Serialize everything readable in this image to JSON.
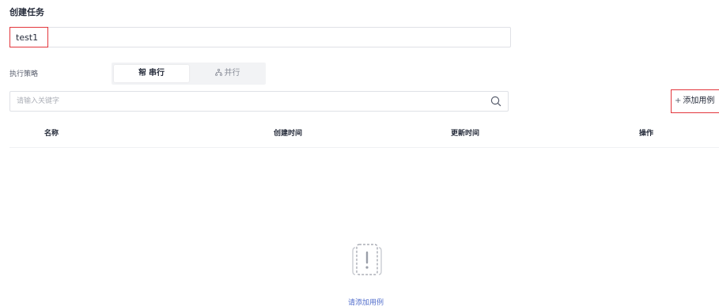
{
  "header": {
    "title": "创建任务"
  },
  "task_name": {
    "value": "test1"
  },
  "strategy": {
    "label": "执行策略",
    "options": [
      {
        "label": "串行",
        "icon": "serial-icon",
        "selected": true
      },
      {
        "label": "并行",
        "icon": "parallel-icon",
        "selected": false
      }
    ]
  },
  "search": {
    "placeholder": "请输入关键字",
    "icon": "search-icon"
  },
  "add_case": {
    "label": "添加用例",
    "icon": "plus-icon"
  },
  "table": {
    "columns": [
      "名称",
      "创建时间",
      "更新时间",
      "操作"
    ],
    "rows": []
  },
  "empty_state": {
    "icon": "empty-document-icon",
    "link_text": "请添加用例"
  },
  "colors": {
    "accent_red": "#e3363c",
    "link_blue": "#526ecc",
    "border": "#dfe1e6"
  }
}
